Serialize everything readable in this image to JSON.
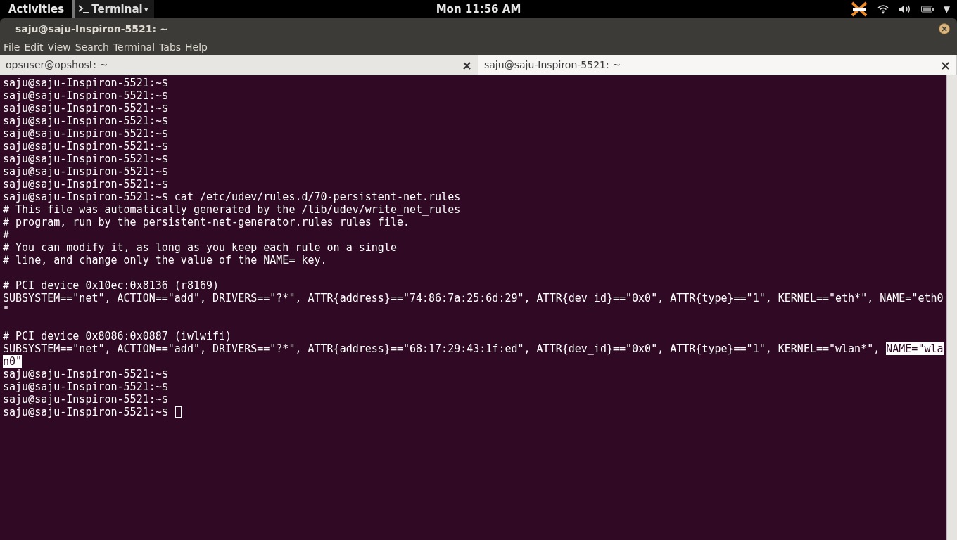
{
  "top_bar": {
    "activities": "Activities",
    "app_menu": {
      "label": "Terminal",
      "caret": "▾"
    },
    "clock": "Mon 11:56 AM",
    "system_menu_caret": "▼"
  },
  "window": {
    "title": "saju@saju-Inspiron-5521: ~"
  },
  "menu": [
    "File",
    "Edit",
    "View",
    "Search",
    "Terminal",
    "Tabs",
    "Help"
  ],
  "tabs": [
    {
      "label": "opsuser@opshost: ~",
      "selected": false,
      "close": "×"
    },
    {
      "label": "saju@saju-Inspiron-5521: ~",
      "selected": true,
      "close": "×"
    }
  ],
  "terminal": {
    "cursor": true,
    "lines": [
      {
        "kind": "text",
        "segments": [
          {
            "text": "saju@saju-Inspiron-5521:~$",
            "selected": false
          }
        ]
      },
      {
        "kind": "text",
        "segments": [
          {
            "text": "saju@saju-Inspiron-5521:~$",
            "selected": false
          }
        ]
      },
      {
        "kind": "text",
        "segments": [
          {
            "text": "saju@saju-Inspiron-5521:~$",
            "selected": false
          }
        ]
      },
      {
        "kind": "text",
        "segments": [
          {
            "text": "saju@saju-Inspiron-5521:~$",
            "selected": false
          }
        ]
      },
      {
        "kind": "text",
        "segments": [
          {
            "text": "saju@saju-Inspiron-5521:~$",
            "selected": false
          }
        ]
      },
      {
        "kind": "text",
        "segments": [
          {
            "text": "saju@saju-Inspiron-5521:~$",
            "selected": false
          }
        ]
      },
      {
        "kind": "text",
        "segments": [
          {
            "text": "saju@saju-Inspiron-5521:~$",
            "selected": false
          }
        ]
      },
      {
        "kind": "text",
        "segments": [
          {
            "text": "saju@saju-Inspiron-5521:~$",
            "selected": false
          }
        ]
      },
      {
        "kind": "text",
        "segments": [
          {
            "text": "saju@saju-Inspiron-5521:~$",
            "selected": false
          }
        ]
      },
      {
        "kind": "text",
        "segments": [
          {
            "text": "saju@saju-Inspiron-5521:~$ cat /etc/udev/rules.d/70-persistent-net.rules",
            "selected": false
          }
        ]
      },
      {
        "kind": "text",
        "segments": [
          {
            "text": "# This file was automatically generated by the /lib/udev/write_net_rules",
            "selected": false
          }
        ]
      },
      {
        "kind": "text",
        "segments": [
          {
            "text": "# program, run by the persistent-net-generator.rules rules file.",
            "selected": false
          }
        ]
      },
      {
        "kind": "text",
        "segments": [
          {
            "text": "#",
            "selected": false
          }
        ]
      },
      {
        "kind": "text",
        "segments": [
          {
            "text": "# You can modify it, as long as you keep each rule on a single",
            "selected": false
          }
        ]
      },
      {
        "kind": "text",
        "segments": [
          {
            "text": "# line, and change only the value of the NAME= key.",
            "selected": false
          }
        ]
      },
      {
        "kind": "blank"
      },
      {
        "kind": "text",
        "segments": [
          {
            "text": "# PCI device 0x10ec:0x8136 (r8169)",
            "selected": false
          }
        ]
      },
      {
        "kind": "text",
        "segments": [
          {
            "text": "SUBSYSTEM==\"net\", ACTION==\"add\", DRIVERS==\"?*\", ATTR{address}==\"74:86:7a:25:6d:29\", ATTR{dev_id}==\"0x0\", ATTR{type}==\"1\", KERNEL==\"eth*\", NAME=\"eth0",
            "selected": false
          }
        ]
      },
      {
        "kind": "text",
        "segments": [
          {
            "text": "\"",
            "selected": false
          }
        ]
      },
      {
        "kind": "blank"
      },
      {
        "kind": "text",
        "segments": [
          {
            "text": "# PCI device 0x8086:0x0887 (iwlwifi)",
            "selected": false
          }
        ]
      },
      {
        "kind": "text",
        "segments": [
          {
            "text": "SUBSYSTEM==\"net\", ACTION==\"add\", DRIVERS==\"?*\", ATTR{address}==\"68:17:29:43:1f:ed\", ATTR{dev_id}==\"0x0\", ATTR{type}==\"1\", KERNEL==\"wlan*\",",
            "selected": false
          },
          {
            "text": "NAME=\"wla",
            "selected": true
          }
        ]
      },
      {
        "kind": "text",
        "segments": [
          {
            "text": "n0\"",
            "selected": true
          }
        ]
      },
      {
        "kind": "text",
        "segments": [
          {
            "text": "saju@saju-Inspiron-5521:~$",
            "selected": false
          }
        ]
      },
      {
        "kind": "text",
        "segments": [
          {
            "text": "saju@saju-Inspiron-5521:~$",
            "selected": false
          }
        ]
      },
      {
        "kind": "text",
        "segments": [
          {
            "text": "saju@saju-Inspiron-5521:~$",
            "selected": false
          }
        ]
      },
      {
        "kind": "text",
        "segments": [
          {
            "text": "saju@saju-Inspiron-5521:~$",
            "selected": false
          }
        ]
      }
    ]
  }
}
